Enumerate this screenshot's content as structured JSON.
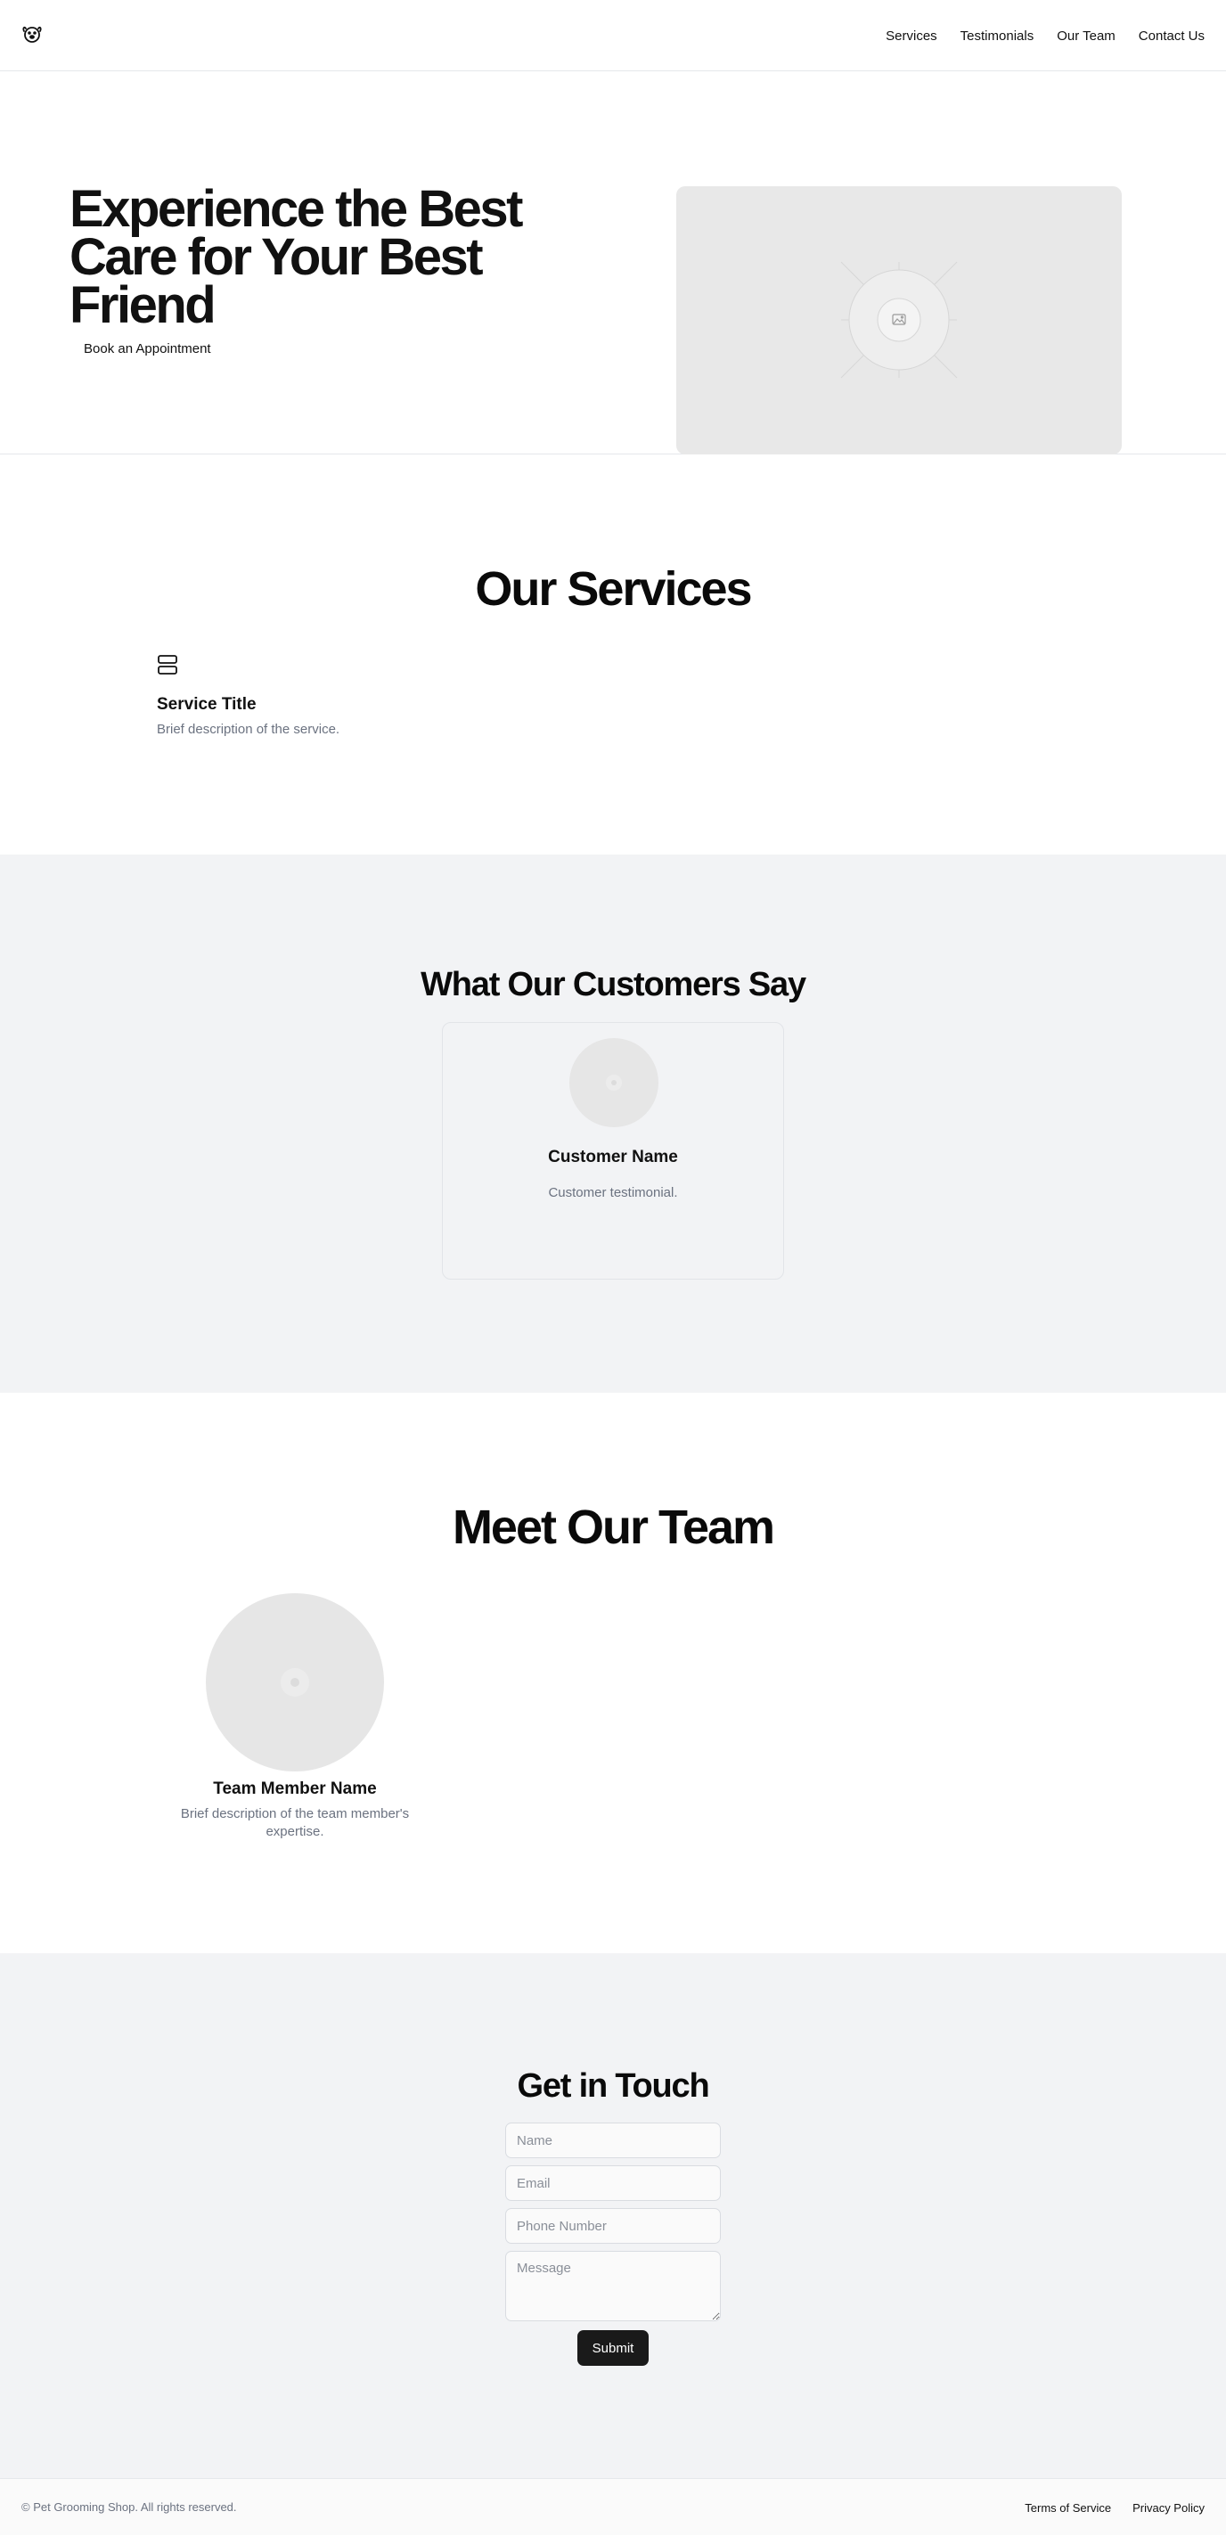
{
  "header": {
    "logo_icon": "paw-dog-icon",
    "nav": [
      "Services",
      "Testimonials",
      "Our Team",
      "Contact Us"
    ]
  },
  "hero": {
    "title": "Experience the Best\nCare for Your Best\nFriend",
    "cta_label": "Book an Appointment",
    "image_icon": "image-placeholder-icon"
  },
  "services": {
    "title": "Our Services",
    "items": [
      {
        "icon": "server-icon",
        "title": "Service Title",
        "description": "Brief description of the service."
      }
    ]
  },
  "testimonials": {
    "title": "What Our Customers Say",
    "items": [
      {
        "name": "Customer Name",
        "text": "Customer testimonial."
      }
    ]
  },
  "team": {
    "title": "Meet Our Team",
    "members": [
      {
        "name": "Team Member Name",
        "description": "Brief description of the team member's expertise."
      }
    ]
  },
  "contact": {
    "title": "Get in Touch",
    "name_placeholder": "Name",
    "email_placeholder": "Email",
    "phone_placeholder": "Phone Number",
    "message_placeholder": "Message",
    "submit_label": "Submit"
  },
  "footer": {
    "copyright": "© Pet Grooming Shop. All rights reserved.",
    "links": [
      "Terms of Service",
      "Privacy Policy"
    ]
  },
  "colors": {
    "text": "#111111",
    "muted": "#6b7280",
    "section_alt_bg": "#f2f3f5",
    "placeholder_bg": "#e8e8e8",
    "button_bg": "#1a1a1a"
  }
}
